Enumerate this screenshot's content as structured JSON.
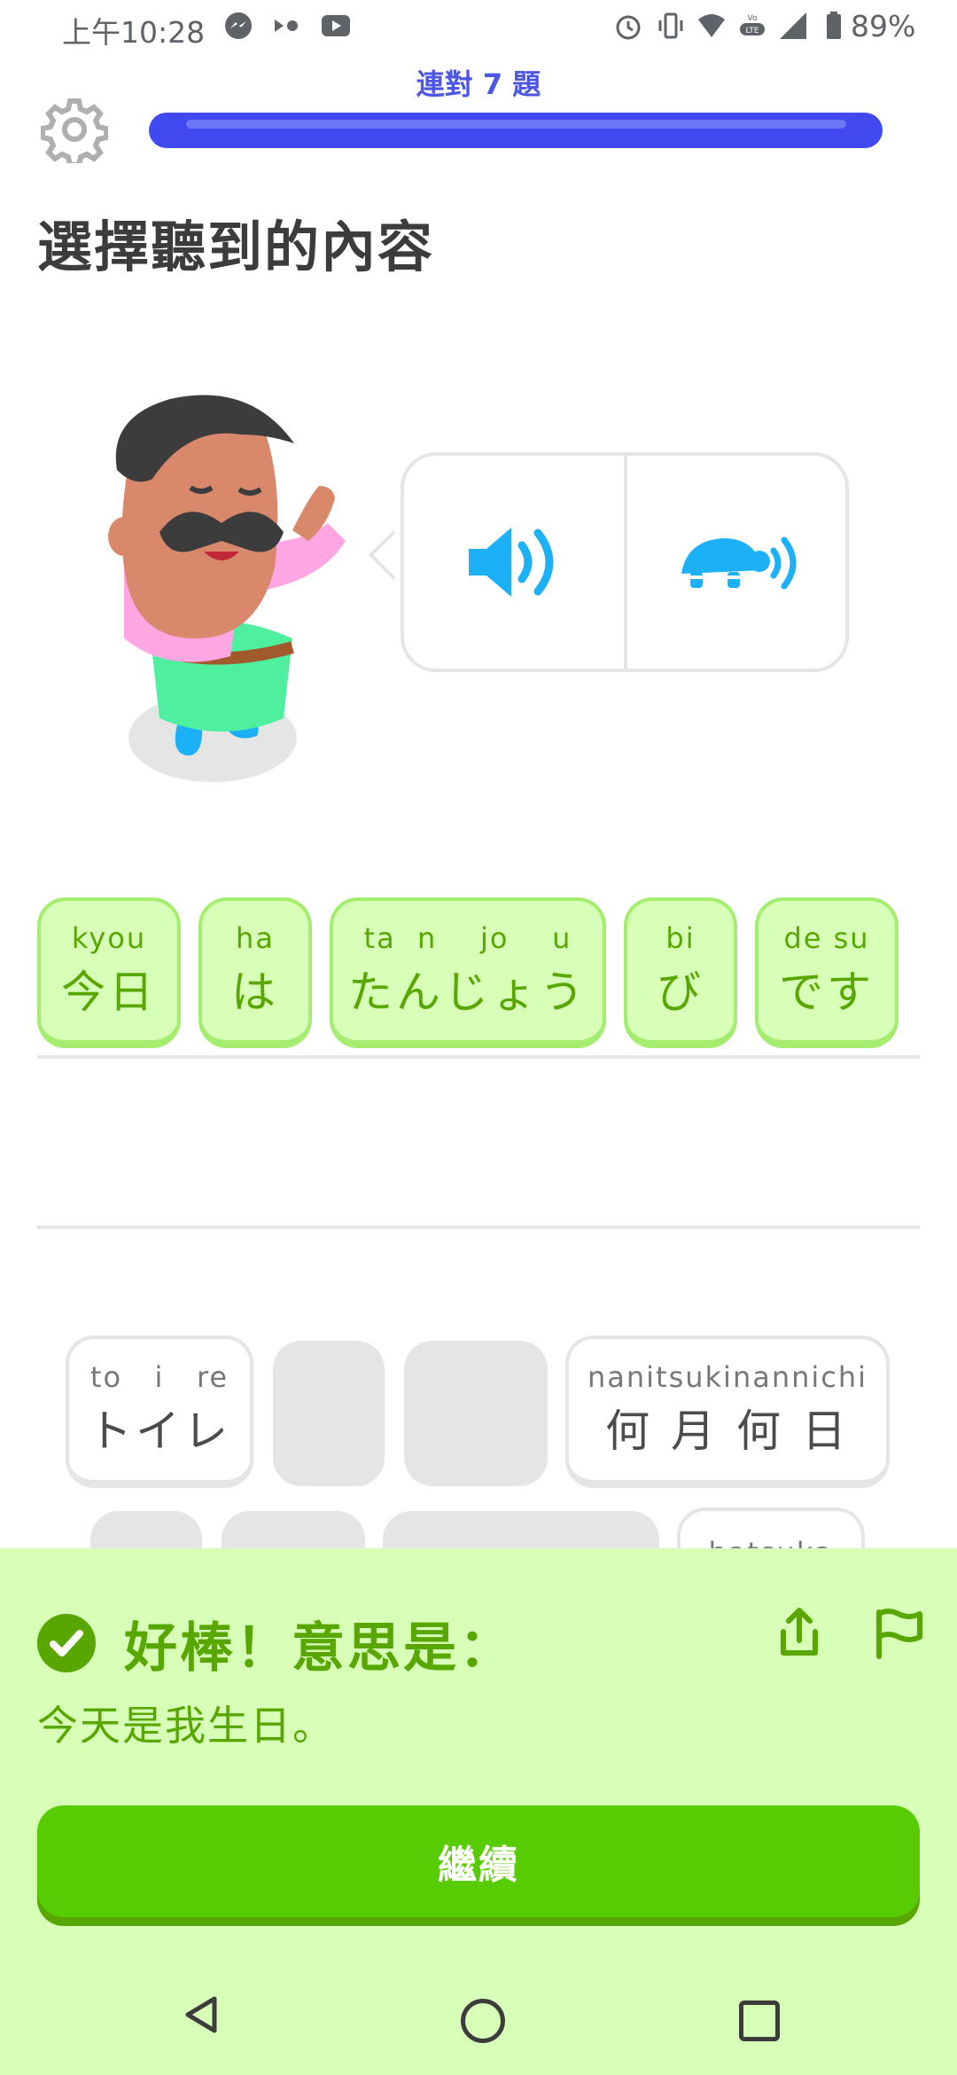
{
  "status_bar": {
    "time": "上午10:28",
    "battery": "89%",
    "icons": [
      "messenger-icon",
      "media-dots-icon",
      "youtube-icon",
      "alarm-icon",
      "vibrate-icon",
      "wifi-icon",
      "volte-icon",
      "signal-icon",
      "battery-icon"
    ]
  },
  "header": {
    "streak": "連對 7 題",
    "progress": 0.95,
    "settings_icon": "gear-icon"
  },
  "prompt": "選擇聽到的內容",
  "audio": {
    "play_icon": "speaker-icon",
    "slow_icon": "turtle-speaker-icon"
  },
  "answer_tiles": [
    {
      "romaji": "kyou",
      "text": "今日"
    },
    {
      "romaji": "ha",
      "text": "は"
    },
    {
      "romaji": "ta  n    jo    u",
      "text": "たんじょう"
    },
    {
      "romaji": "bi",
      "text": "び"
    },
    {
      "romaji": "de su",
      "text": "です"
    }
  ],
  "bank_tiles": [
    {
      "romaji": "to   i   re",
      "text": "トイレ"
    },
    {
      "romaji": "nanitsukinannichi",
      "text": "何 月 何 日"
    },
    {
      "romaji": "hatsuka",
      "text": ""
    }
  ],
  "feedback": {
    "title": "好棒！意思是：",
    "translation": "今天是我生日。",
    "continue_label": "繼續",
    "share_icon": "share-icon",
    "report_icon": "flag-icon"
  },
  "colors": {
    "accent_blue": "#4049f0",
    "correct_green": "#58cc02",
    "panel_bg": "#d7ffb8",
    "tile_border": "#a5ed6e",
    "text_green": "#58a700"
  }
}
